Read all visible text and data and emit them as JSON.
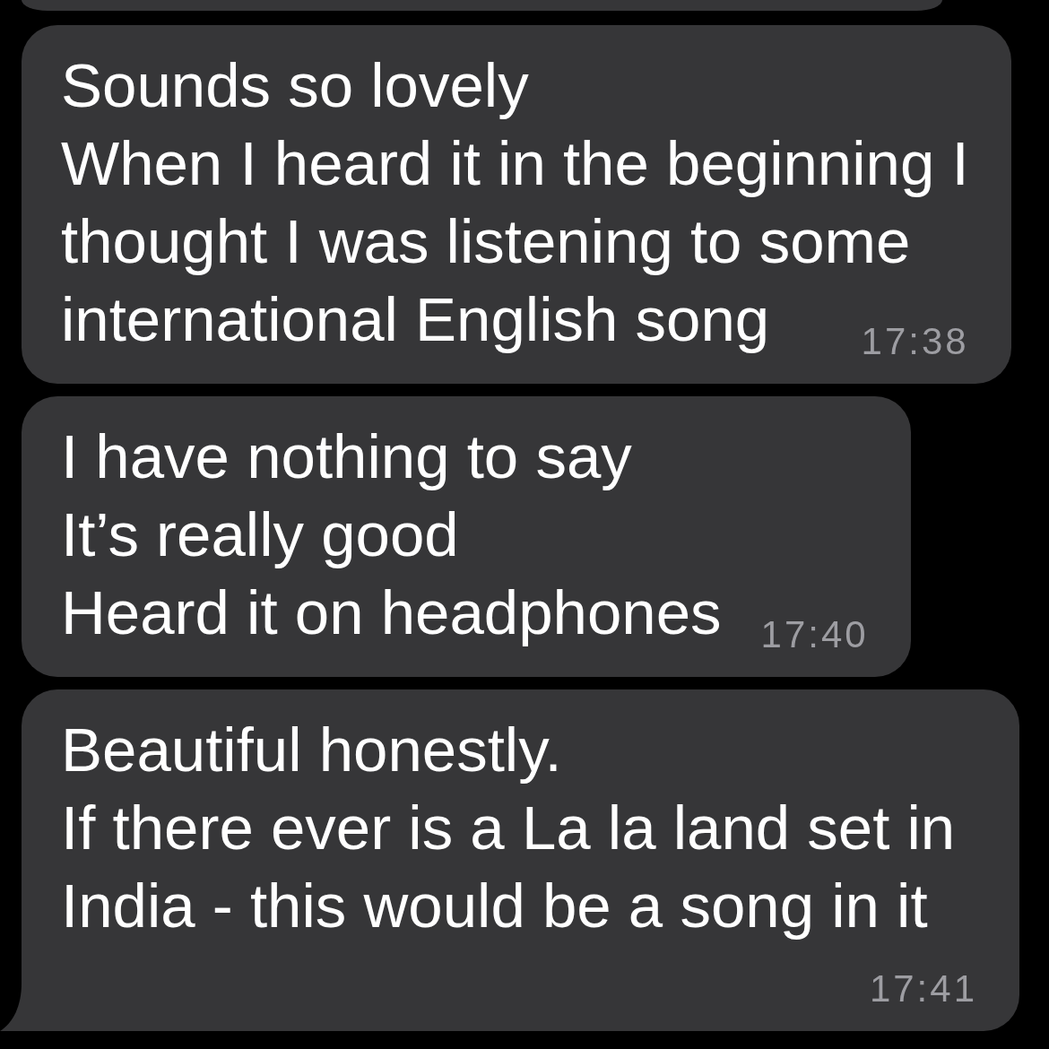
{
  "messages": [
    {
      "kind": "cut_off",
      "tail": false
    },
    {
      "kind": "text",
      "lines": [
        "Sounds so lovely",
        "When I heard it in the beginning I",
        "thought I was listening to some",
        "international English song"
      ],
      "time": "17:38",
      "tail": false
    },
    {
      "kind": "text",
      "lines": [
        "I have nothing to say",
        "It’s really good",
        "Heard it on headphones"
      ],
      "time": "17:40",
      "tail": false
    },
    {
      "kind": "text",
      "lines": [
        "Beautiful honestly.",
        "If there ever is a La la land set in",
        "India - this would be a song in it"
      ],
      "time": "17:41",
      "tail": true
    }
  ]
}
